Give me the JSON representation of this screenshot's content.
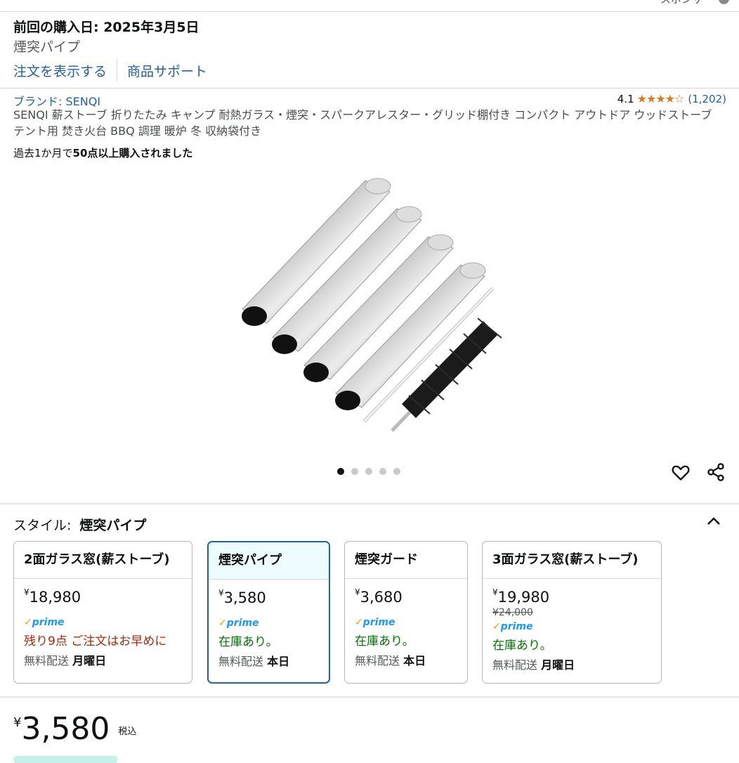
{
  "sponsor": "スポンサー",
  "last_purchase": {
    "title": "前回の購入日: 2025年3月5日",
    "item": "煙突パイプ",
    "view_order": "注文を表示する",
    "support": "商品サポート"
  },
  "product": {
    "brand": "ブランド: SENQI",
    "rating": "4.1",
    "stars": 4.1,
    "review_count": "(1,202)",
    "title": "SENQI 薪ストーブ 折りたたみ キャンプ 耐熱ガラス・煙突・スパークアレスター・グリッド棚付き コンパクト アウトドア ウッドストーブ テント用 焚き火台 BBQ 調理 暖炉 冬 収納袋付き",
    "bought_prefix": "過去1か月で",
    "bought_bold": "50点以上購入されました",
    "image_count": 5,
    "active_image": 1
  },
  "style": {
    "label": "スタイル:",
    "selected": "煙突パイプ",
    "options": [
      {
        "name": "2面ガラス窓(薪ストーブ)",
        "yen": "¥",
        "price": "18,980",
        "list_price": "",
        "prime": "prime",
        "stock": "残り9点 ご注文はお早めに",
        "delivery_label": "無料配送",
        "delivery_day": "月曜日"
      },
      {
        "name": "煙突パイプ",
        "yen": "¥",
        "price": "3,580",
        "list_price": "",
        "prime": "prime",
        "stock": "在庫あり。",
        "delivery_label": "無料配送",
        "delivery_day": "本日"
      },
      {
        "name": "煙突ガード",
        "yen": "¥",
        "price": "3,680",
        "list_price": "",
        "prime": "prime",
        "stock": "在庫あり。",
        "delivery_label": "無料配送",
        "delivery_day": "本日"
      },
      {
        "name": "3面ガラス窓(薪ストーブ)",
        "yen": "¥",
        "price": "19,980",
        "list_price": "¥24,000",
        "prime": "prime",
        "stock": "在庫あり。",
        "delivery_label": "無料配送",
        "delivery_day": "月曜日"
      }
    ]
  },
  "buy": {
    "yen": "¥",
    "price": "3,580",
    "tax": "税込"
  },
  "colors": {
    "link": "#2162a1",
    "star": "#de7921",
    "selected_border": "#2162a1",
    "selected_bg": "#edfdff",
    "low_stock": "#b12704",
    "in_stock": "#007600"
  }
}
